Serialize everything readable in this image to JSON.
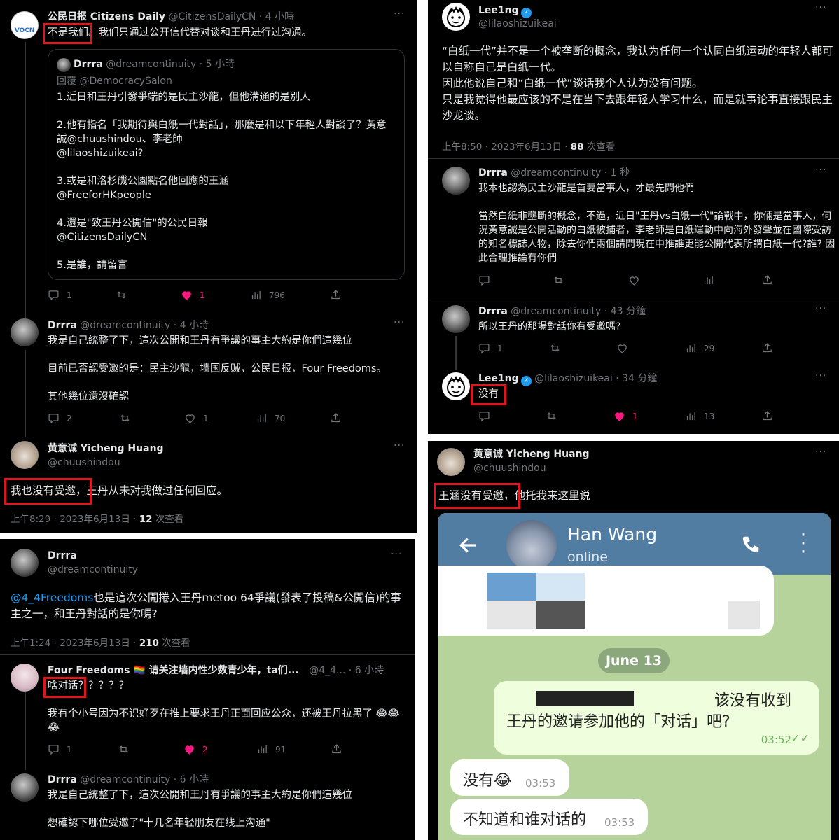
{
  "panel1": {
    "t1": {
      "name": "公民日报 Citizens Daily",
      "handle": "@CitizensDailyCN · 4 小時",
      "avatar_text": "VOCN",
      "text_hl": "不是我们",
      "text_rest": "。我们只通过公开信代替对谈和王丹进行过沟通。",
      "quote": {
        "name": "Drrra",
        "handle": "@dreamcontinuity · 5 小時",
        "reply_to": "回覆 @DemocracySalon",
        "body": "1.近日和王丹引發爭端的是民主沙龍，但他溝通的是別人\n\n2.他有指名「我期待與白紙一代對話」，那麼是和以下年輕人對談了？黃意誠@chuushindou、李老師\n@lilaoshizuikeai?\n\n3.或是和洛杉磯公園點名他回應的王涵\n@FreeforHKpeople\n\n4.還是\"致王丹公開信\"的公民日報\n@CitizensDailyCN\n\n5.是誰，請留言"
      },
      "replies": "1",
      "retweets": "",
      "likes": "1",
      "views": "796"
    },
    "t2": {
      "name": "Drrra",
      "handle": "@dreamcontinuity · 4 小時",
      "body": "我是自己統整了下，這次公開和王丹有爭議的事主大約是你們這幾位\n\n目前已否認受邀的是：民主沙龍，墙国反贼，公民日报，Four Freedoms。\n\n其他幾位還沒確認",
      "replies": "2",
      "retweets": "",
      "likes": "1",
      "views": "70"
    },
    "t3": {
      "name": "黄意诚 Yicheng Huang",
      "handle": "@chuushindou",
      "text_hl": "我也没有受邀，",
      "text_rest": "王丹从未对我做过任何回应。",
      "time": "上午8:29 · 2023年6月13日 · ",
      "views_num": "12",
      "views_label": " 次查看"
    }
  },
  "panel2": {
    "t1": {
      "name": "Lee1ng",
      "handle": "@lilaoshizuikeai",
      "body": "“白纸一代”并不是一个被垄断的概念，我认为任何一个认同白纸运动的年轻人都可以自称自己是白纸一代。\n因此他说自己和“白纸一代”谈话我个人认为没有问题。\n只是我觉得他最应该的不是在当下去跟年轻人学习什么，而是就事论事直接跟民主沙龙谈。",
      "time": "上午8:50 · 2023年6月13日 · ",
      "views_num": "88",
      "views_label": " 次查看"
    },
    "t2": {
      "name": "Drrra",
      "handle": "@dreamcontinuity · 1 秒",
      "body": "我本也認為民主沙龍是首要當事人，才最先問他們\n\n當然白紙非壟斷的概念，不過，近日\"王丹vs白紙一代\"論戰中，你倆是當事人，何況黃意誠是公開活動的白紙被捕者，李老師是白紙運動中向海外發聲並在國際受訪的知名標誌人物，除去你們兩個請問現在中推誰更能公開代表所謂白紙一代?誰? 因此合理推論有你們"
    },
    "t3": {
      "name": "Drrra",
      "handle": "@dreamcontinuity · 43 分鐘",
      "body": "所以王丹的那場對話你有受邀嗎?",
      "replies": "1",
      "views": "29"
    },
    "t4": {
      "name": "Lee1ng",
      "handle": "@lilaoshizuikeai · 34 分鐘",
      "text_hl": "没有",
      "likes": "1",
      "views": "13"
    }
  },
  "panel3": {
    "t1": {
      "name": "Drrra",
      "handle": "@dreamcontinuity",
      "mention": "@4_4Freedoms",
      "body": "也是這次公開捲入王丹metoo 64爭議(發表了投稿&公開信)的事主之一，和王丹對話的是你嗎?",
      "time": "上午1:24 · 2023年6月13日 · ",
      "views_num": "210",
      "views_label": " 次查看"
    },
    "t2": {
      "name": "Four Freedoms 🏳️‍🌈 请关注墙内性少数青少年，ta们...",
      "handle": "@4_4... · 6 小時",
      "text_hl": "啥对话",
      "text_rest": "？？？？？",
      "body": "我有个小号因为不识好歹在推上要求王丹正面回应公众，还被王丹拉黑了 😂😂😂",
      "replies": "1",
      "likes": "2",
      "views": "91"
    },
    "t3": {
      "name": "Drrra",
      "handle": "@dreamcontinuity · 6 小時",
      "body": "我是自己統整了下，這次公開和王丹有爭議的事主大約是你們這幾位\n\n想確認下哪位受邀了\"十几名年轻朋友在线上沟通\""
    }
  },
  "panel4": {
    "t1": {
      "name": "黄意诚 Yicheng Huang",
      "handle": "@chuushindou",
      "text_hl": "王涵没有受邀，",
      "text_rest": "他托我来这里说"
    },
    "chat": {
      "contact": "Han Wang",
      "status": "online",
      "date": "June 13",
      "msg1_line1": "该没有收到",
      "msg1_line2": "王丹的邀请参加他的「对话」吧?",
      "msg1_time": "03:52",
      "msg2": "没有😂",
      "msg2_time": "03:53",
      "msg3": "不知道和谁对话的",
      "msg3_time": "03:53"
    }
  }
}
